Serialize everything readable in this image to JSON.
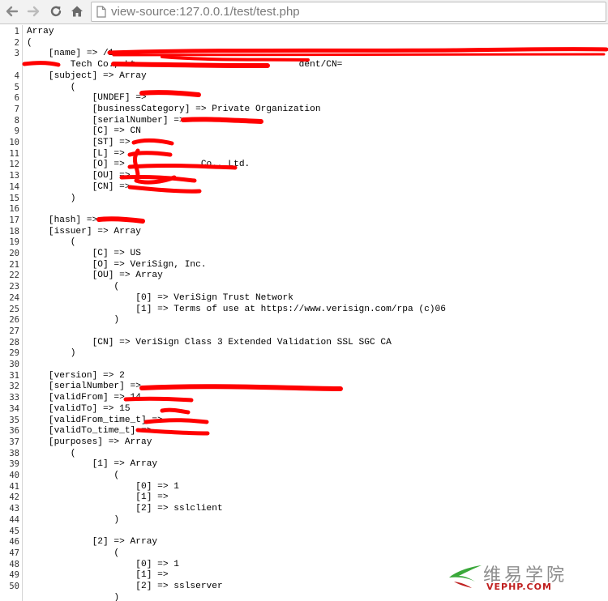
{
  "browser": {
    "url": "view-source:127.0.0.1/test/test.php",
    "back_icon": "arrow-left-icon",
    "forward_icon": "arrow-right-icon",
    "reload_icon": "reload-icon",
    "home_icon": "home-icon",
    "page_icon": "page-icon"
  },
  "source_lines": [
    {
      "n": "1",
      "text": "Array"
    },
    {
      "n": "2",
      "text": "("
    },
    {
      "n": "3",
      "text": "    [name] => /1"
    },
    {
      "n": "",
      "text": "        Tech Co., Lt                              dent/CN="
    },
    {
      "n": "4",
      "text": "    [subject] => Array"
    },
    {
      "n": "5",
      "text": "        ("
    },
    {
      "n": "6",
      "text": "            [UNDEF] =>"
    },
    {
      "n": "7",
      "text": "            [businessCategory] => Private Organization"
    },
    {
      "n": "8",
      "text": "            [serialNumber] =>"
    },
    {
      "n": "9",
      "text": "            [C] => CN"
    },
    {
      "n": "10",
      "text": "            [ST] =>"
    },
    {
      "n": "11",
      "text": "            [L] =>"
    },
    {
      "n": "12",
      "text": "            [O] =>              Co., Ltd."
    },
    {
      "n": "13",
      "text": "            [OU] =>"
    },
    {
      "n": "14",
      "text": "            [CN] =>"
    },
    {
      "n": "15",
      "text": "        )"
    },
    {
      "n": "16",
      "text": ""
    },
    {
      "n": "17",
      "text": "    [hash] =>"
    },
    {
      "n": "18",
      "text": "    [issuer] => Array"
    },
    {
      "n": "19",
      "text": "        ("
    },
    {
      "n": "20",
      "text": "            [C] => US"
    },
    {
      "n": "21",
      "text": "            [O] => VeriSign, Inc."
    },
    {
      "n": "22",
      "text": "            [OU] => Array"
    },
    {
      "n": "23",
      "text": "                ("
    },
    {
      "n": "24",
      "text": "                    [0] => VeriSign Trust Network"
    },
    {
      "n": "25",
      "text": "                    [1] => Terms of use at https://www.verisign.com/rpa (c)06"
    },
    {
      "n": "26",
      "text": "                )"
    },
    {
      "n": "27",
      "text": ""
    },
    {
      "n": "28",
      "text": "            [CN] => VeriSign Class 3 Extended Validation SSL SGC CA"
    },
    {
      "n": "29",
      "text": "        )"
    },
    {
      "n": "30",
      "text": ""
    },
    {
      "n": "31",
      "text": "    [version] => 2"
    },
    {
      "n": "32",
      "text": "    [serialNumber] =>"
    },
    {
      "n": "33",
      "text": "    [validFrom] => 14"
    },
    {
      "n": "34",
      "text": "    [validTo] => 15"
    },
    {
      "n": "35",
      "text": "    [validFrom_time_t] =>"
    },
    {
      "n": "36",
      "text": "    [validTo_time_t] =>"
    },
    {
      "n": "37",
      "text": "    [purposes] => Array"
    },
    {
      "n": "38",
      "text": "        ("
    },
    {
      "n": "39",
      "text": "            [1] => Array"
    },
    {
      "n": "40",
      "text": "                ("
    },
    {
      "n": "41",
      "text": "                    [0] => 1"
    },
    {
      "n": "42",
      "text": "                    [1] =>"
    },
    {
      "n": "43",
      "text": "                    [2] => sslclient"
    },
    {
      "n": "44",
      "text": "                )"
    },
    {
      "n": "45",
      "text": ""
    },
    {
      "n": "46",
      "text": "            [2] => Array"
    },
    {
      "n": "47",
      "text": "                ("
    },
    {
      "n": "48",
      "text": "                    [0] => 1"
    },
    {
      "n": "49",
      "text": "                    [1] =>"
    },
    {
      "n": "50",
      "text": "                    [2] => sslserver"
    },
    {
      "n": "",
      "text": "                )"
    }
  ],
  "watermark": {
    "cn": "维易学院",
    "en": "VEPHP.COM",
    "logo_icon": "vephp-logo-icon",
    "accent": "#3aa83a"
  },
  "redaction_color": "#ff0000"
}
